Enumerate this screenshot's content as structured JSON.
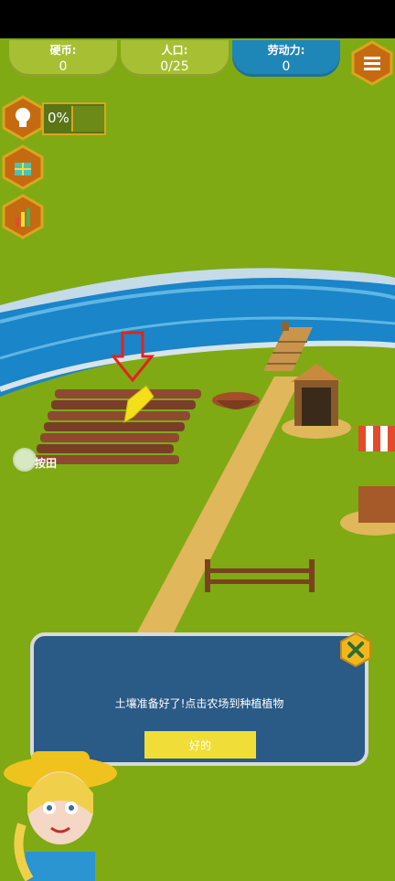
{
  "hud": {
    "coins": {
      "label": "硬币:",
      "value": "0"
    },
    "population": {
      "label": "人口:",
      "value": "0/25"
    },
    "labor": {
      "label": "劳动力:",
      "value": "0"
    }
  },
  "side_buttons": {
    "hint": "lightbulb-icon",
    "gift": "gift-icon",
    "stats": "bar-chart-icon",
    "menu": "menu-icon"
  },
  "progress": {
    "text": "0%"
  },
  "field": {
    "label": "按田"
  },
  "dialog": {
    "message": "土壤准备好了!点击农场到种植植物",
    "ok_label": "好的",
    "close_icon": "close-icon"
  },
  "colors": {
    "grass": "#7faa14",
    "river": "#1a85c8",
    "path": "#e1b75b",
    "dialog": "#2a5a86",
    "button": "#f0dd38",
    "hex_border": "#d9a620",
    "hex_fill": "#c66a12"
  }
}
